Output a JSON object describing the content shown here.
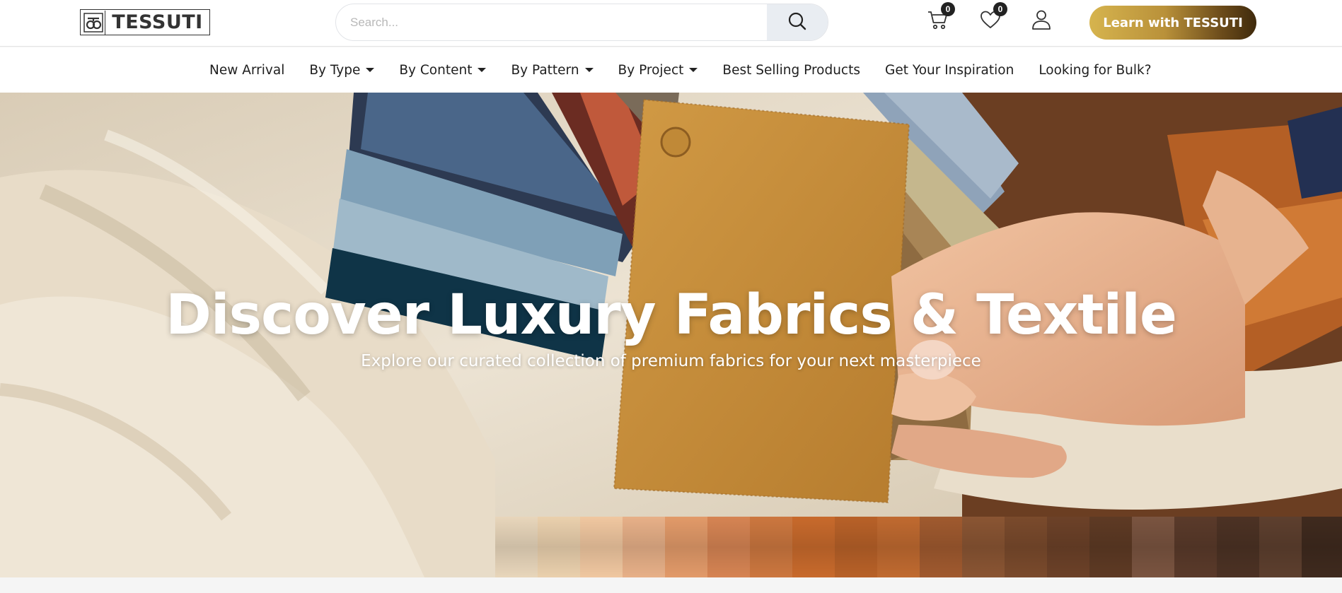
{
  "header": {
    "logo_text": "TESSUTI",
    "search": {
      "placeholder": "Search..."
    },
    "cart_count": "0",
    "wishlist_count": "0",
    "cta_label": "Learn with TESSUTI"
  },
  "nav": {
    "items": [
      {
        "label": "New Arrival",
        "dropdown": false
      },
      {
        "label": "By Type",
        "dropdown": true
      },
      {
        "label": "By Content",
        "dropdown": true
      },
      {
        "label": "By Pattern",
        "dropdown": true
      },
      {
        "label": "By Project",
        "dropdown": true
      },
      {
        "label": "Best Selling Products",
        "dropdown": false
      },
      {
        "label": "Get Your Inspiration",
        "dropdown": false
      },
      {
        "label": "Looking for Bulk?",
        "dropdown": false
      }
    ]
  },
  "hero": {
    "title": "Discover Luxury Fabrics & Textile",
    "subtitle": "Explore our curated collection of premium fabrics for your next masterpiece"
  },
  "colors": {
    "cta_gradient_start": "#d6b44e",
    "cta_gradient_end": "#3f2a0c",
    "swatch": "#c9923f",
    "linen": "#e6dac8"
  }
}
